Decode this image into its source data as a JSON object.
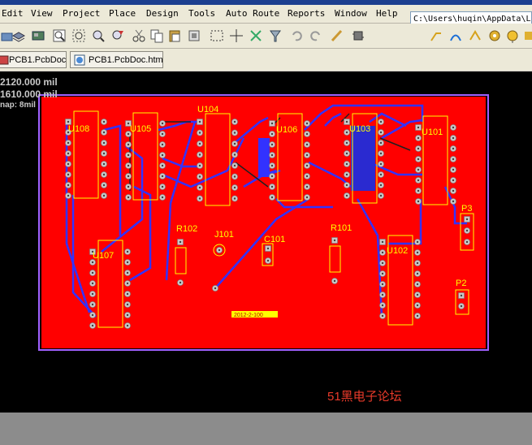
{
  "menu": {
    "items": [
      {
        "key": "edit",
        "label": "Edit"
      },
      {
        "key": "view",
        "label": "View"
      },
      {
        "key": "project",
        "label": "Project"
      },
      {
        "key": "place",
        "label": "Place"
      },
      {
        "key": "design",
        "label": "Design"
      },
      {
        "key": "tools",
        "label": "Tools"
      },
      {
        "key": "autoroute",
        "label": "Auto Route"
      },
      {
        "key": "reports",
        "label": "Reports"
      },
      {
        "key": "window",
        "label": "Window"
      },
      {
        "key": "help",
        "label": "Help"
      }
    ],
    "path": "C:\\Users\\huqin\\AppData\\L"
  },
  "tabs": [
    {
      "label": "PCB1.PcbDoc"
    },
    {
      "label": "PCB1.PcbDoc.htm"
    }
  ],
  "status": {
    "x": "2120.000 mil",
    "y": "1610.000 mil",
    "snap": "nap: 8mil"
  },
  "board": {
    "components": [
      "U108",
      "U105",
      "U104",
      "U106",
      "U103",
      "U101",
      "U107",
      "U102",
      "R102",
      "J101",
      "C101",
      "R101",
      "P3",
      "P2"
    ],
    "label_text": "2012-2-100",
    "colors": {
      "board": "#ff0000",
      "bottom_trace": "#3232ff",
      "overlay": "#ffff00",
      "pad": "#c0c0c0"
    }
  },
  "watermark": "51黑电子论坛"
}
